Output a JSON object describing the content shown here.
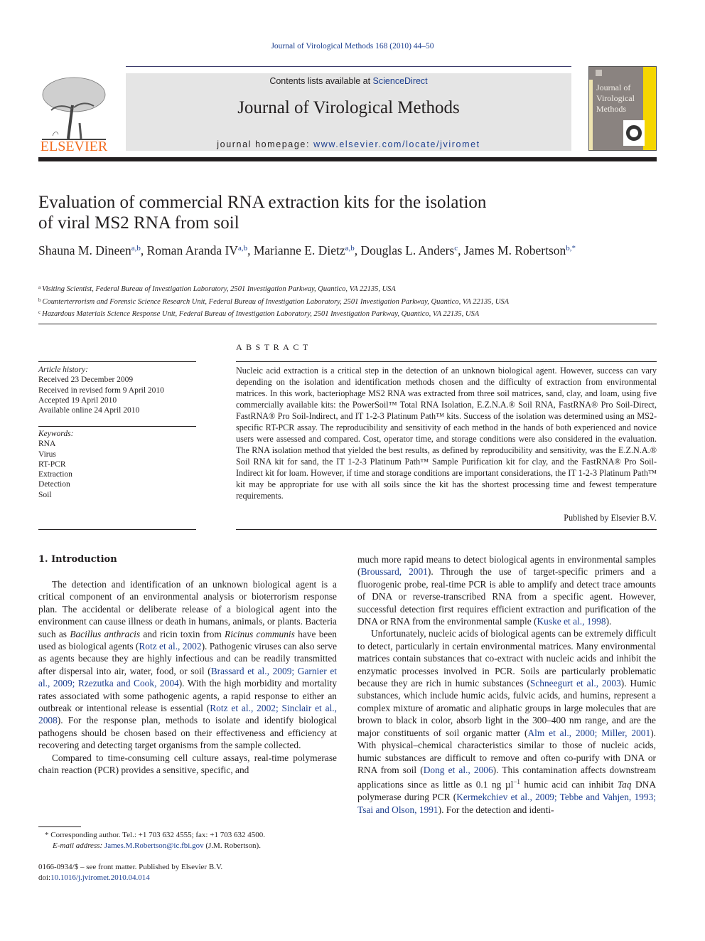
{
  "header": {
    "running_head": "Journal of Virological Methods 168 (2010) 44–50",
    "contents_prefix": "Contents lists available at ",
    "contents_link": "ScienceDirect",
    "journal_title": "Journal of Virological Methods",
    "homepage_prefix": "journal homepage: ",
    "homepage_link": "www.elsevier.com/locate/jviromet",
    "publisher_logo_text": "ELSEVIER",
    "cover_title_lines": [
      "Journal of",
      "Virological",
      "Methods"
    ],
    "colors": {
      "link": "#1d3f8f",
      "elsevier_orange": "#f26b1d",
      "cover_yellow": "#f5d600",
      "cover_gray": "#8a8380",
      "masthead_bg": "#e5e5e5"
    }
  },
  "article": {
    "title_line1": "Evaluation of commercial RNA extraction kits for the isolation",
    "title_line2": "of viral MS2 RNA from soil",
    "authors": [
      {
        "name": "Shauna M. Dineen",
        "aff": "a,b"
      },
      {
        "name": "Roman Aranda IV",
        "aff": "a,b"
      },
      {
        "name": "Marianne E. Dietz",
        "aff": "a,b"
      },
      {
        "name": "Douglas L. Anders",
        "aff": "c"
      },
      {
        "name": "James M. Robertson",
        "aff": "b,*"
      }
    ],
    "affiliations": [
      {
        "key": "a",
        "text": "Visiting Scientist, Federal Bureau of Investigation Laboratory, 2501 Investigation Parkway, Quantico, VA 22135, USA"
      },
      {
        "key": "b",
        "text": "Counterterrorism and Forensic Science Research Unit, Federal Bureau of Investigation Laboratory, 2501 Investigation Parkway, Quantico, VA 22135, USA"
      },
      {
        "key": "c",
        "text": "Hazardous Materials Science Response Unit, Federal Bureau of Investigation Laboratory, 2501 Investigation Parkway, Quantico, VA 22135, USA"
      }
    ]
  },
  "article_info": {
    "history_heading": "Article history:",
    "history": [
      "Received 23 December 2009",
      "Received in revised form 9 April 2010",
      "Accepted 19 April 2010",
      "Available online 24 April 2010"
    ],
    "keywords_heading": "Keywords:",
    "keywords": [
      "RNA",
      "Virus",
      "RT-PCR",
      "Extraction",
      "Detection",
      "Soil"
    ]
  },
  "abstract": {
    "heading": "ABSTRACT",
    "text": "Nucleic acid extraction is a critical step in the detection of an unknown biological agent. However, success can vary depending on the isolation and identification methods chosen and the difficulty of extraction from environmental matrices. In this work, bacteriophage MS2 RNA was extracted from three soil matrices, sand, clay, and loam, using five commercially available kits: the PowerSoil™ Total RNA Isolation, E.Z.N.A.® Soil RNA, FastRNA® Pro Soil-Direct, FastRNA® Pro Soil-Indirect, and IT 1-2-3 Platinum Path™ kits. Success of the isolation was determined using an MS2-specific RT-PCR assay. The reproducibility and sensitivity of each method in the hands of both experienced and novice users were assessed and compared. Cost, operator time, and storage conditions were also considered in the evaluation. The RNA isolation method that yielded the best results, as defined by reproducibility and sensitivity, was the E.Z.N.A.® Soil RNA kit for sand, the IT 1-2-3 Platinum Path™ Sample Purification kit for clay, and the FastRNA® Pro Soil-Indirect kit for loam. However, if time and storage conditions are important considerations, the IT 1-2-3 Platinum Path™ kit may be appropriate for use with all soils since the kit has the shortest processing time and fewest temperature requirements.",
    "published_by": "Published by Elsevier B.V."
  },
  "introduction": {
    "heading": "1.  Introduction",
    "left_p1": [
      {
        "t": "The detection and identification of an unknown biological agent is a critical component of an environmental analysis or bioterrorism response plan. The accidental or deliberate release of a biological agent into the environment can cause illness or death in humans, animals, or plants. Bacteria such as "
      },
      {
        "i": "Bacillus anthracis"
      },
      {
        "t": " and ricin toxin from "
      },
      {
        "i": "Ricinus communis"
      },
      {
        "t": " have been used as biological agents ("
      },
      {
        "l": "Rotz et al., 2002"
      },
      {
        "t": "). Pathogenic viruses can also serve as agents because they are highly infectious and can be readily transmitted after dispersal into air, water, food, or soil ("
      },
      {
        "l": "Brassard et al., 2009; Garnier et al., 2009; Rzezutka and Cook, 2004"
      },
      {
        "t": "). With the high morbidity and mortality rates associated with some pathogenic agents, a rapid response to either an outbreak or intentional release is essential ("
      },
      {
        "l": "Rotz et al., 2002; Sinclair et al., 2008"
      },
      {
        "t": "). For the response plan, methods to isolate and identify biological pathogens should be chosen based on their effectiveness and efficiency at recovering and detecting target organisms from the sample collected."
      }
    ],
    "left_p2": [
      {
        "t": "Compared to time-consuming cell culture assays, real-time polymerase chain reaction (PCR) provides a sensitive, specific, and"
      }
    ],
    "right_p1": [
      {
        "t": "much more rapid means to detect biological agents in environmental samples ("
      },
      {
        "l": "Broussard, 2001"
      },
      {
        "t": "). Through the use of target-specific primers and a fluorogenic probe, real-time PCR is able to amplify and detect trace amounts of DNA or reverse-transcribed RNA from a specific agent. However, successful detection first requires efficient extraction and purification of the DNA or RNA from the environmental sample ("
      },
      {
        "l": "Kuske et al., 1998"
      },
      {
        "t": ")."
      }
    ],
    "right_p2": [
      {
        "t": "Unfortunately, nucleic acids of biological agents can be extremely difficult to detect, particularly in certain environmental matrices. Many environmental matrices contain substances that co-extract with nucleic acids and inhibit the enzymatic processes involved in PCR. Soils are particularly problematic because they are rich in humic substances ("
      },
      {
        "l": "Schneegurt et al., 2003"
      },
      {
        "t": "). Humic substances, which include humic acids, fulvic acids, and humins, represent a complex mixture of aromatic and aliphatic groups in large molecules that are brown to black in color, absorb light in the 300–400 nm range, and are the major constituents of soil organic matter ("
      },
      {
        "l": "Alm et al., 2000; Miller, 2001"
      },
      {
        "t": "). With physical–chemical characteristics similar to those of nucleic acids, humic substances are difficult to remove and often co-purify with DNA or RNA from soil ("
      },
      {
        "l": "Dong et al., 2006"
      },
      {
        "t": "). This contamination affects downstream applications since as little as 0.1 ng µl"
      },
      {
        "sup": "−1"
      },
      {
        "t": " humic acid can inhibit "
      },
      {
        "i": "Taq"
      },
      {
        "t": " DNA polymerase during PCR ("
      },
      {
        "l": "Kermekchiev et al., 2009; Tebbe and Vahjen, 1993; Tsai and Olson, 1991"
      },
      {
        "t": "). For the detection and identi-"
      }
    ]
  },
  "footnote": {
    "marker": "*",
    "corresponding": " Corresponding author. Tel.: +1 703 632 4555; fax: +1 703 632 4500.",
    "email_label": "E-mail address: ",
    "email": "James.M.Robertson@ic.fbi.gov",
    "email_suffix": " (J.M. Robertson)."
  },
  "front_matter": {
    "issn_line": "0166-0934/$ – see front matter. Published by Elsevier B.V.",
    "doi_prefix": "doi:",
    "doi": "10.1016/j.jviromet.2010.04.014"
  }
}
